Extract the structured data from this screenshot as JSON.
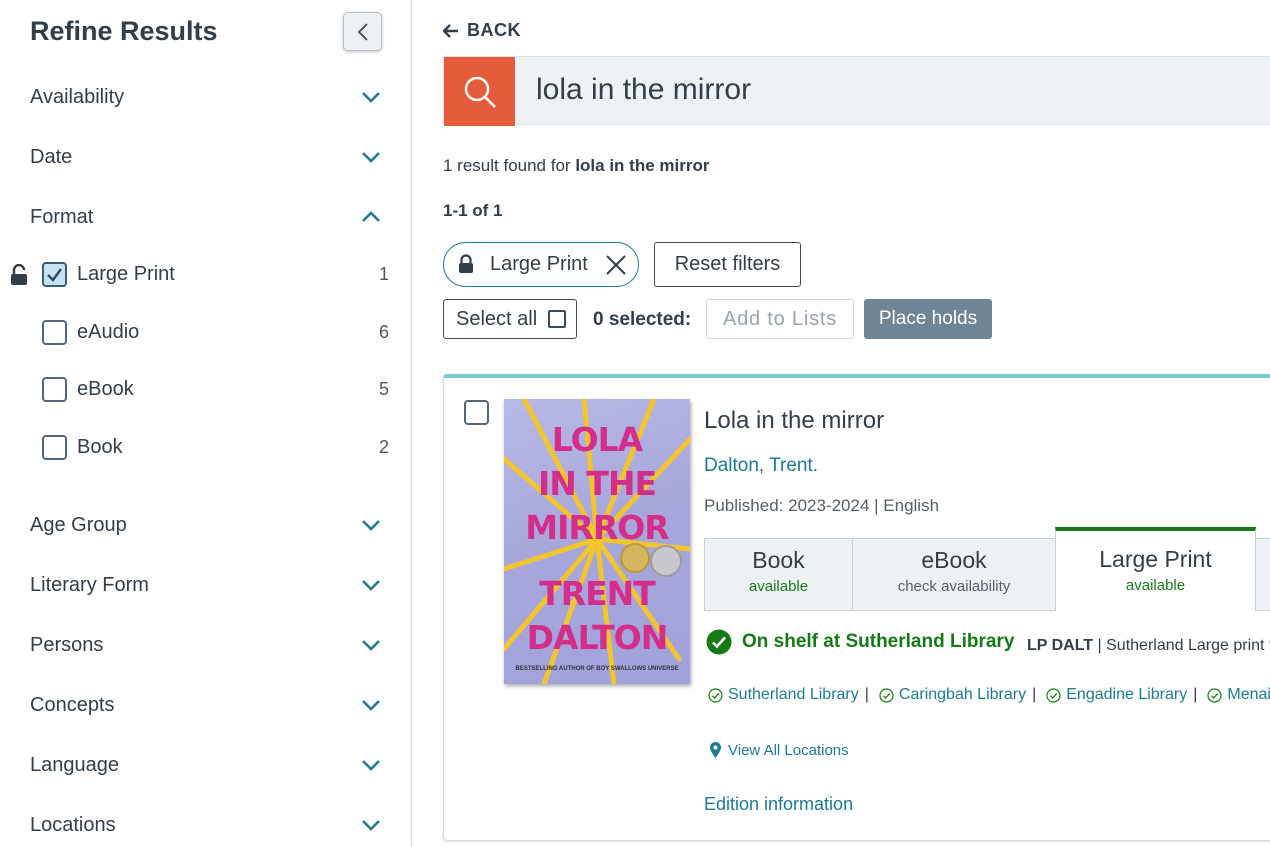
{
  "sidebar": {
    "title": "Refine Results",
    "facets_top": [
      {
        "label": "Availability",
        "state": "collapsed"
      },
      {
        "label": "Date",
        "state": "collapsed"
      },
      {
        "label": "Format",
        "state": "expanded"
      }
    ],
    "format_options": [
      {
        "label": "Large Print",
        "count": "1",
        "checked": true,
        "locked": true
      },
      {
        "label": "eAudio",
        "count": "6",
        "checked": false
      },
      {
        "label": "eBook",
        "count": "5",
        "checked": false
      },
      {
        "label": "Book",
        "count": "2",
        "checked": false
      }
    ],
    "facets_bottom": [
      {
        "label": "Age Group"
      },
      {
        "label": "Literary Form"
      },
      {
        "label": "Persons"
      },
      {
        "label": "Concepts"
      },
      {
        "label": "Language"
      },
      {
        "label": "Locations"
      }
    ]
  },
  "header": {
    "back_label": "BACK"
  },
  "search": {
    "query": "lola in the mirror"
  },
  "results": {
    "summary_prefix": "1 result found for",
    "summary_query": "lola in the mirror",
    "range": "1-1 of 1"
  },
  "filters": {
    "active_chip": "Large Print",
    "reset_label": "Reset filters"
  },
  "toolbar": {
    "select_all_label": "Select all",
    "selected_text": "0 selected:",
    "add_to_lists_label": "Add to Lists",
    "place_holds_label": "Place holds"
  },
  "item": {
    "title": "Lola in the mirror",
    "author": "Dalton, Trent.",
    "published": "Published: 2023-2024 | English",
    "cover": {
      "lines": [
        "LOLA",
        "IN THE",
        "MIRROR",
        "TRENT",
        "DALTON"
      ],
      "tagline": "BESTSELLING AUTHOR OF BOY SWALLOWS UNIVERSE"
    },
    "format_tabs": [
      {
        "name": "Book",
        "status": "available",
        "status_color": "#1a7a1a",
        "active": false
      },
      {
        "name": "eBook",
        "status": "check availability",
        "status_color": "#555f68",
        "active": false
      },
      {
        "name": "Large Print",
        "status": "available",
        "status_color": "#1a7a1a",
        "active": true
      }
    ],
    "on_shelf": "On shelf at Sutherland Library",
    "call_number": "LP DALT",
    "call_location": "| Sutherland Large print f",
    "libraries": [
      "Sutherland Library",
      "Caringbah Library",
      "Engadine Library",
      "Menai"
    ],
    "view_all_label": "View All Locations",
    "edition_label": "Edition information"
  },
  "colors": {
    "accent": "#e55c3c",
    "link": "#1e7a91",
    "available_green": "#1a7a1a",
    "place_holds_bg": "#6f8596"
  }
}
